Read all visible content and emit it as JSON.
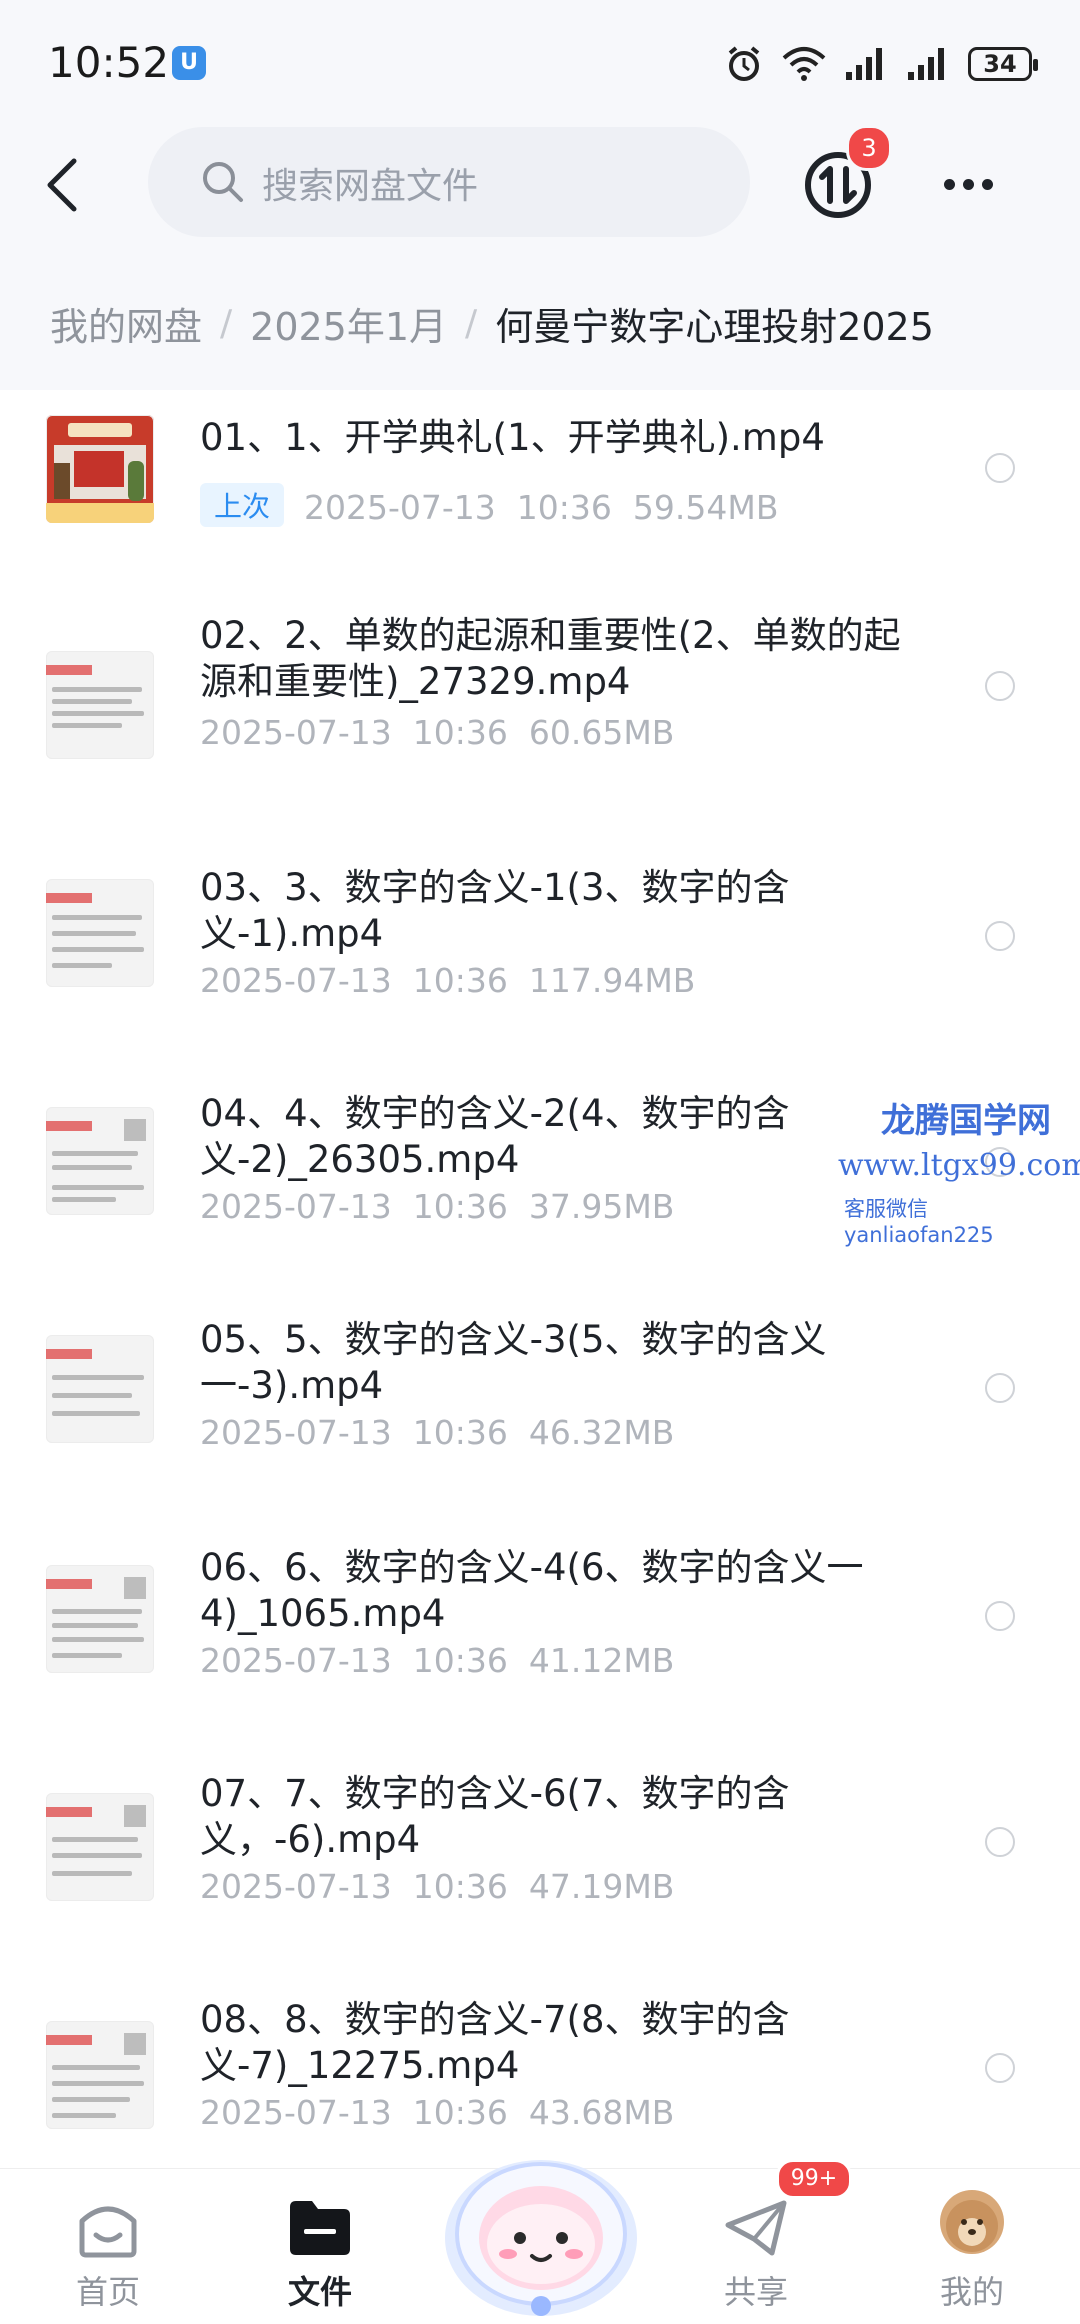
{
  "status_bar": {
    "time": "10:52",
    "app_badge": "U",
    "battery": "34"
  },
  "header": {
    "search_placeholder": "搜索网盘文件",
    "transfer_badge": "3"
  },
  "breadcrumb": {
    "items": [
      "我的网盘",
      "2025年1月"
    ],
    "separator": "/",
    "current": "何曼宁数字心理投射2025"
  },
  "files": [
    {
      "name": "01、1、开学典礼(1、开学典礼).mp4",
      "tag": "上次",
      "date": "2025-07-13",
      "time": "10:36",
      "size": "59.54MB"
    },
    {
      "name": "02、2、单数的起源和重要性(2、单数的起源和重要性)_27329.mp4",
      "date": "2025-07-13",
      "time": "10:36",
      "size": "60.65MB"
    },
    {
      "name": "03、3、数字的含义-1(3、数字的含义-1).mp4",
      "date": "2025-07-13",
      "time": "10:36",
      "size": "117.94MB"
    },
    {
      "name": "04、4、数宇的含义-2(4、数宇的含义-2)_26305.mp4",
      "date": "2025-07-13",
      "time": "10:36",
      "size": "37.95MB"
    },
    {
      "name": "05、5、数字的含义-3(5、数字的含义一-3).mp4",
      "date": "2025-07-13",
      "time": "10:36",
      "size": "46.32MB"
    },
    {
      "name": "06、6、数字的含义-4(6、数字的含义一4)_1065.mp4",
      "date": "2025-07-13",
      "time": "10:36",
      "size": "41.12MB"
    },
    {
      "name": "07、7、数字的含义-6(7、数字的含义，-6).mp4",
      "date": "2025-07-13",
      "time": "10:36",
      "size": "47.19MB"
    },
    {
      "name": "08、8、数宇的含义-7(8、数宇的含义-7)_12275.mp4",
      "date": "2025-07-13",
      "time": "10:36",
      "size": "43.68MB"
    }
  ],
  "watermark": {
    "title": "龙腾国学网",
    "url": "www.ltgx99.com",
    "wechat": "客服微信 yanliaofan225"
  },
  "bottom_nav": {
    "home": "首页",
    "files": "文件",
    "share": "共享",
    "share_badge": "99+",
    "me": "我的"
  },
  "colors": {
    "accent": "#2b8cf0",
    "badge": "#f04848",
    "watermark": "#3f6fd8"
  }
}
